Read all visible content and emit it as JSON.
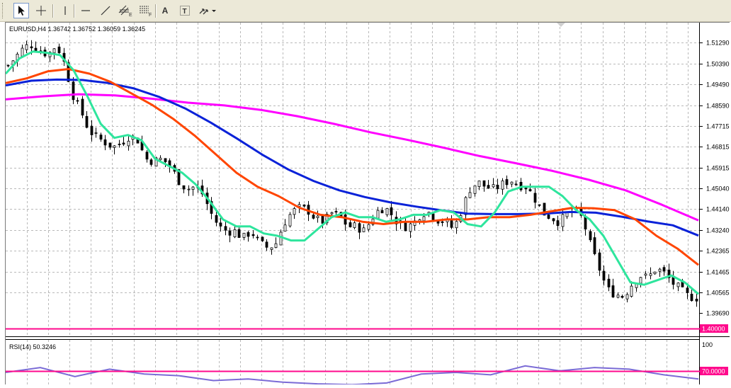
{
  "toolbar": {
    "tools": [
      {
        "name": "cursor-tool",
        "icon": "arrow-pointer-icon",
        "active": true
      },
      {
        "name": "crosshair-tool",
        "icon": "crosshair-icon"
      },
      {
        "name": "vertical-line-tool",
        "icon": "vertical-line-icon"
      },
      {
        "name": "horizontal-line-tool",
        "icon": "horizontal-line-icon"
      },
      {
        "name": "trendline-tool",
        "icon": "trendline-icon"
      },
      {
        "name": "equidistant-channel-tool",
        "icon": "equidistant-channel-icon",
        "letter": "E"
      },
      {
        "name": "fibonacci-retracement-tool",
        "icon": "fibonacci-icon",
        "letter": "F"
      },
      {
        "name": "text-tool",
        "icon": "text-icon",
        "label": "A"
      },
      {
        "name": "text-label-tool",
        "icon": "text-label-icon",
        "label": "T"
      },
      {
        "name": "arrows-tool",
        "icon": "arrows-dropdown-icon"
      }
    ]
  },
  "main_chart": {
    "info_line": "EURUSD,H4  1.36742 1.36752 1.36059 1.36245",
    "symbol": "EURUSD",
    "timeframe": "H4",
    "ohlc": {
      "open": 1.36742,
      "high": 1.36752,
      "low": 1.36059,
      "close": 1.36245
    },
    "price_labels": [
      "1.51290",
      "1.50390",
      "1.49490",
      "1.48590",
      "1.47715",
      "1.46815",
      "1.45915",
      "1.45040",
      "1.44140",
      "1.43240",
      "1.42365",
      "1.41465",
      "1.40565",
      "1.39690"
    ],
    "current_level_label": "1.40000",
    "current_level": 1.4
  },
  "rsi_panel": {
    "label": "RSI(14) 50.3246",
    "scale_top": "100",
    "level_label": "70.0000",
    "level": 70
  },
  "colors": {
    "background": "#ffffff",
    "grid": "#b9b9b9",
    "candles": "#000000",
    "ma_fast": "#2ee59d",
    "ma_mid": "#ff4500",
    "ma_slow": "#0a22d8",
    "ma_long": "#ff00ff",
    "level_line": "#ff0a8c",
    "rsi_line": "#7b6bd6",
    "toolbar": "#ece9d8"
  },
  "chart_data": {
    "type": "line",
    "y_range": [
      1.3969,
      1.5129
    ],
    "x_tick_count": 32,
    "candles": {
      "count": 150,
      "close_path": [
        1.503,
        1.507,
        1.511,
        1.512,
        1.509,
        1.508,
        1.512,
        1.503,
        1.49,
        1.483,
        1.475,
        1.472,
        1.47,
        1.468,
        1.47,
        1.473,
        1.471,
        1.463,
        1.462,
        1.463,
        1.46,
        1.454,
        1.45,
        1.451,
        1.448,
        1.44,
        1.434,
        1.432,
        1.432,
        1.429,
        1.432,
        1.427,
        1.425,
        1.426,
        1.435,
        1.44,
        1.442,
        1.441,
        1.437,
        1.436,
        1.44,
        1.438,
        1.434,
        1.434,
        1.432,
        1.438,
        1.442,
        1.441,
        1.436,
        1.434,
        1.435,
        1.44,
        1.44,
        1.437,
        1.436,
        1.433,
        1.441,
        1.45,
        1.453,
        1.451,
        1.45,
        1.452,
        1.454,
        1.452,
        1.451,
        1.446,
        1.44,
        1.438,
        1.436,
        1.439,
        1.441,
        1.437,
        1.425,
        1.416,
        1.407,
        1.405,
        1.404,
        1.409,
        1.413,
        1.412,
        1.416,
        1.414,
        1.41,
        1.407,
        1.404,
        1.4035
      ],
      "note": "close_path holds anchor closes; individual candles are interpolated with small noise"
    },
    "series": [
      {
        "name": "ma_fast",
        "color": "#2ee59d",
        "values": [
          1.4995,
          1.506,
          1.509,
          1.5085,
          1.5075,
          1.501,
          1.49,
          1.478,
          1.472,
          1.4732,
          1.471,
          1.463,
          1.46,
          1.457,
          1.452,
          1.445,
          1.437,
          1.434,
          1.434,
          1.431,
          1.43,
          1.428,
          1.428,
          1.433,
          1.438,
          1.44,
          1.438,
          1.438,
          1.436,
          1.437,
          1.439,
          1.439,
          1.441,
          1.44,
          1.435,
          1.434,
          1.44,
          1.449,
          1.451,
          1.451,
          1.451,
          1.447,
          1.441,
          1.437,
          1.43,
          1.42,
          1.41,
          1.409,
          1.411,
          1.413,
          1.41,
          1.405
        ]
      },
      {
        "name": "ma_mid",
        "color": "#ff4500",
        "values": [
          1.4955,
          1.4975,
          1.5005,
          1.5015,
          1.4995,
          1.496,
          1.491,
          1.486,
          1.48,
          1.473,
          1.465,
          1.457,
          1.451,
          1.447,
          1.442,
          1.439,
          1.438,
          1.436,
          1.435,
          1.436,
          1.436,
          1.437,
          1.437,
          1.438,
          1.438,
          1.439,
          1.4405,
          1.442,
          1.4418,
          1.441,
          1.437,
          1.43,
          1.4245,
          1.4175
        ]
      },
      {
        "name": "ma_slow",
        "color": "#0a22d8",
        "values": [
          1.4945,
          1.4965,
          1.497,
          1.4968,
          1.4955,
          1.4932,
          1.4895,
          1.4846,
          1.4785,
          1.4718,
          1.4648,
          1.4585,
          1.4535,
          1.4495,
          1.4466,
          1.4443,
          1.4425,
          1.4409,
          1.4395,
          1.4393,
          1.4393,
          1.4395,
          1.4402,
          1.4399,
          1.4382,
          1.4362,
          1.4345,
          1.4301
        ]
      },
      {
        "name": "ma_long",
        "color": "#ff00ff",
        "values": [
          1.4885,
          1.4898,
          1.4907,
          1.4902,
          1.4888,
          1.4871,
          1.4859,
          1.484,
          1.4813,
          1.478,
          1.4744,
          1.4712,
          1.4678,
          1.4642,
          1.4611,
          1.4578,
          1.454,
          1.4495,
          1.4433,
          1.4366
        ]
      }
    ],
    "rsi_series": {
      "name": "rsi",
      "values": [
        60,
        66,
        55,
        64,
        58,
        56,
        50,
        52,
        48,
        46,
        45,
        47,
        58,
        60,
        57,
        68,
        62,
        66,
        64,
        57,
        52
      ]
    }
  }
}
